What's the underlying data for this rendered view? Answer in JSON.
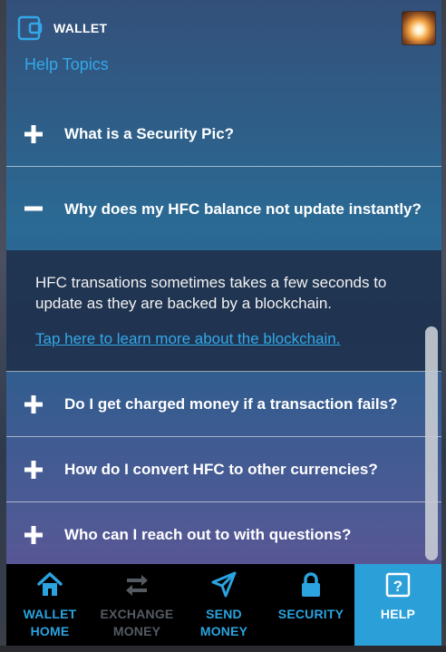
{
  "header": {
    "title": "WALLET",
    "help_topics": "Help Topics"
  },
  "faq": {
    "items": [
      {
        "question": "What is a Security Pic?",
        "expanded": false
      },
      {
        "question": "Why does my HFC balance not update instantly?",
        "expanded": true,
        "answer": "HFC transations sometimes takes a few seconds to update as they are backed by a blockchain.",
        "link": "Tap here to learn more about the blockchain."
      },
      {
        "question": "Do I get charged money if a transaction fails?",
        "expanded": false
      },
      {
        "question": "How do I convert HFC to other currencies?",
        "expanded": false
      },
      {
        "question": "Who can I reach out to with questions?",
        "expanded": false
      }
    ]
  },
  "tabs": [
    {
      "label_line1": "WALLET",
      "label_line2": "HOME",
      "icon": "home-icon"
    },
    {
      "label_line1": "EXCHANGE",
      "label_line2": "MONEY",
      "icon": "exchange-arrows-icon"
    },
    {
      "label_line1": "SEND",
      "label_line2": "MONEY",
      "icon": "paper-plane-icon"
    },
    {
      "label_line1": "SECURITY",
      "label_line2": "",
      "icon": "lock-icon"
    },
    {
      "label_line1": "HELP",
      "label_line2": "",
      "icon": "question-box-icon"
    }
  ],
  "colors": {
    "accent": "#33a8e8",
    "active_tab": "#2a9fd8",
    "disabled_tab": "#555a62"
  }
}
